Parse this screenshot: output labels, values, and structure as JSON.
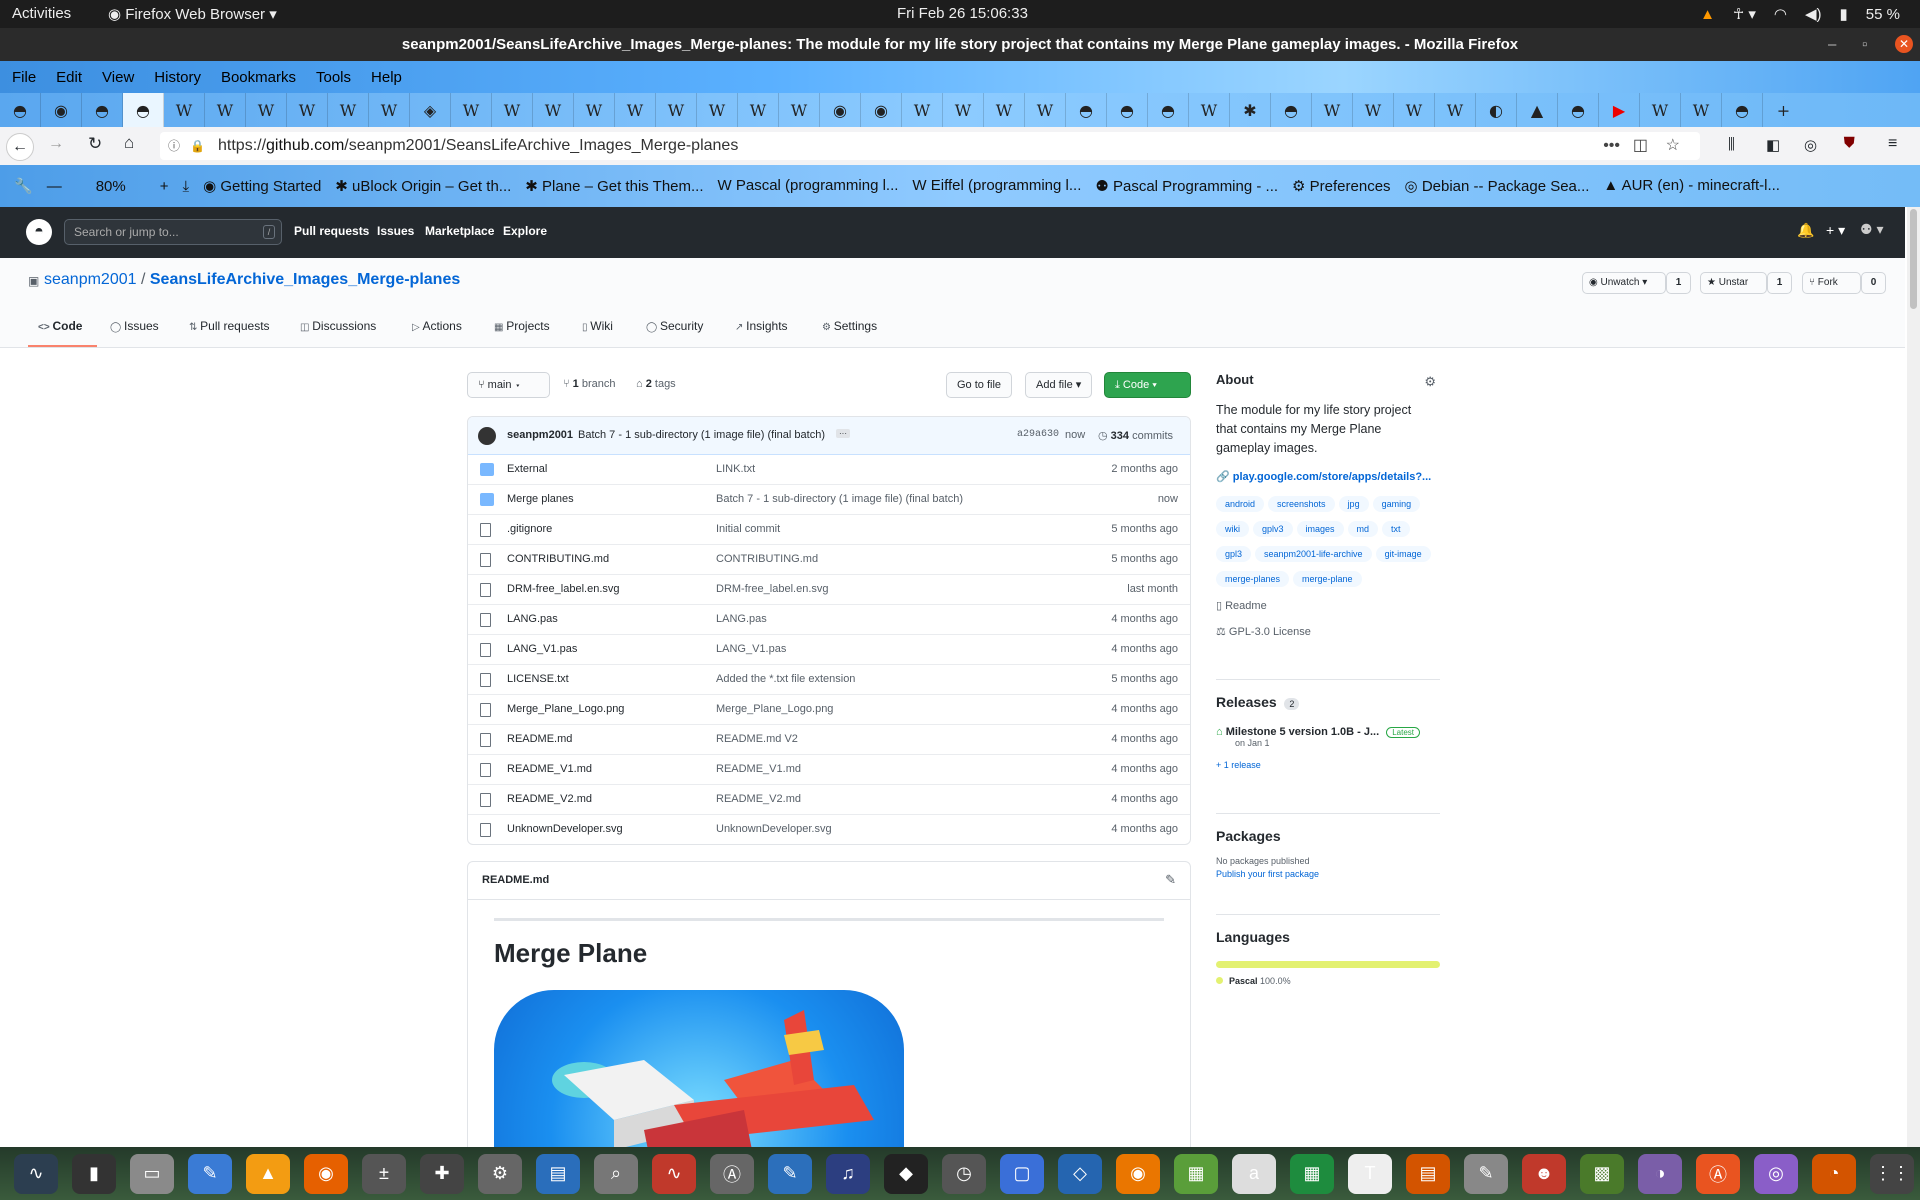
{
  "system": {
    "activities": "Activities",
    "app_menu": "Firefox Web Browser",
    "clock": "Fri Feb 26  15:06:33",
    "battery": "55 %"
  },
  "window": {
    "title": "seanpm2001/SeansLifeArchive_Images_Merge-planes: The module for my life story project that contains my Merge Plane gameplay images. - Mozilla Firefox"
  },
  "menu": [
    "File",
    "Edit",
    "View",
    "History",
    "Bookmarks",
    "Tools",
    "Help"
  ],
  "tabs": [
    "github",
    "firefox",
    "github",
    "github",
    "W",
    "W",
    "W",
    "W",
    "W",
    "W",
    "◈",
    "W",
    "W",
    "W",
    "W",
    "W",
    "W",
    "W",
    "W",
    "W",
    "◉",
    "◉",
    "W",
    "W",
    "W",
    "W",
    "github",
    "github",
    "github",
    "W",
    "✱",
    "github",
    "W",
    "W",
    "W",
    "W",
    "◐",
    "▲",
    "github",
    "▶",
    "W",
    "W",
    "github"
  ],
  "url": {
    "prefix": "https://",
    "host": "github.com",
    "path": "/seanpm2001/SeansLifeArchive_Images_Merge-planes"
  },
  "zoom": "80%",
  "bookmarks": [
    "Getting Started",
    "uBlock Origin – Get th...",
    "Plane – Get this Them...",
    "Pascal (programming l...",
    "Eiffel (programming l...",
    "Pascal Programming - ...",
    "Preferences",
    "Debian -- Package Sea...",
    "AUR (en) - minecraft-l..."
  ],
  "gh": {
    "search_placeholder": "Search or jump to...",
    "search_key": "/",
    "nav": [
      "Pull requests",
      "Issues",
      "Marketplace",
      "Explore"
    ]
  },
  "repo": {
    "owner": "seanpm2001",
    "sep": "/",
    "name": "SeansLifeArchive_Images_Merge-planes",
    "unwatch": "Unwatch",
    "watch_count": "1",
    "unstar": "Unstar",
    "star_count": "1",
    "fork": "Fork",
    "fork_count": "0",
    "tabs": [
      "Code",
      "Issues",
      "Pull requests",
      "Discussions",
      "Actions",
      "Projects",
      "Wiki",
      "Security",
      "Insights",
      "Settings"
    ],
    "branch": "main",
    "branch_count": "1",
    "branch_label": "branch",
    "tag_count": "2",
    "tag_label": "tags",
    "goto_file": "Go to file",
    "add_file": "Add file",
    "code_btn": "Code"
  },
  "commit": {
    "author": "seanpm2001",
    "message": "Batch 7 - 1 sub-directory (1 image file) (final batch)",
    "ellipsis": "···",
    "sha": "a29a630",
    "time": "now",
    "count": "334",
    "count_label": "commits"
  },
  "files": [
    {
      "type": "dir",
      "name": "External",
      "msg": "LINK.txt",
      "age": "2 months ago"
    },
    {
      "type": "dir",
      "name": "Merge planes",
      "msg": "Batch 7 - 1 sub-directory (1 image file) (final batch)",
      "age": "now"
    },
    {
      "type": "file",
      "name": ".gitignore",
      "msg": "Initial commit",
      "age": "5 months ago"
    },
    {
      "type": "file",
      "name": "CONTRIBUTING.md",
      "msg": "CONTRIBUTING.md",
      "age": "5 months ago"
    },
    {
      "type": "file",
      "name": "DRM-free_label.en.svg",
      "msg": "DRM-free_label.en.svg",
      "age": "last month"
    },
    {
      "type": "file",
      "name": "LANG.pas",
      "msg": "LANG.pas",
      "age": "4 months ago"
    },
    {
      "type": "file",
      "name": "LANG_V1.pas",
      "msg": "LANG_V1.pas",
      "age": "4 months ago"
    },
    {
      "type": "file",
      "name": "LICENSE.txt",
      "msg": "Added the *.txt file extension",
      "age": "5 months ago"
    },
    {
      "type": "file",
      "name": "Merge_Plane_Logo.png",
      "msg": "Merge_Plane_Logo.png",
      "age": "4 months ago"
    },
    {
      "type": "file",
      "name": "README.md",
      "msg": "README.md V2",
      "age": "4 months ago"
    },
    {
      "type": "file",
      "name": "README_V1.md",
      "msg": "README_V1.md",
      "age": "4 months ago"
    },
    {
      "type": "file",
      "name": "README_V2.md",
      "msg": "README_V2.md",
      "age": "4 months ago"
    },
    {
      "type": "file",
      "name": "UnknownDeveloper.svg",
      "msg": "UnknownDeveloper.svg",
      "age": "4 months ago"
    }
  ],
  "readme": {
    "file": "README.md",
    "heading": "Merge Plane"
  },
  "about": {
    "title": "About",
    "description": "The module for my life story project that contains my Merge Plane gameplay images.",
    "link": "play.google.com/store/apps/details?...",
    "topics": [
      "android",
      "screenshots",
      "jpg",
      "gaming",
      "wiki",
      "gplv3",
      "images",
      "md",
      "txt",
      "gpl3",
      "seanpm2001-life-archive",
      "git-image",
      "merge-planes",
      "merge-plane"
    ],
    "readme": "Readme",
    "license": "GPL-3.0 License"
  },
  "releases": {
    "title": "Releases",
    "count": "2",
    "latest_name": "Milestone 5 version 1.0B - J...",
    "latest_badge": "Latest",
    "latest_date": "on Jan 1",
    "more": "+ 1 release"
  },
  "packages": {
    "title": "Packages",
    "none": "No packages published",
    "publish": "Publish your first package"
  },
  "languages": {
    "title": "Languages",
    "name": "Pascal",
    "percent": "100.0%",
    "share": 1.0,
    "color": "#E3F171"
  },
  "colors": {
    "accent": "#0366d6",
    "green": "#2ea44f",
    "header": "#24292e",
    "tab_underline": "#f9826c"
  }
}
